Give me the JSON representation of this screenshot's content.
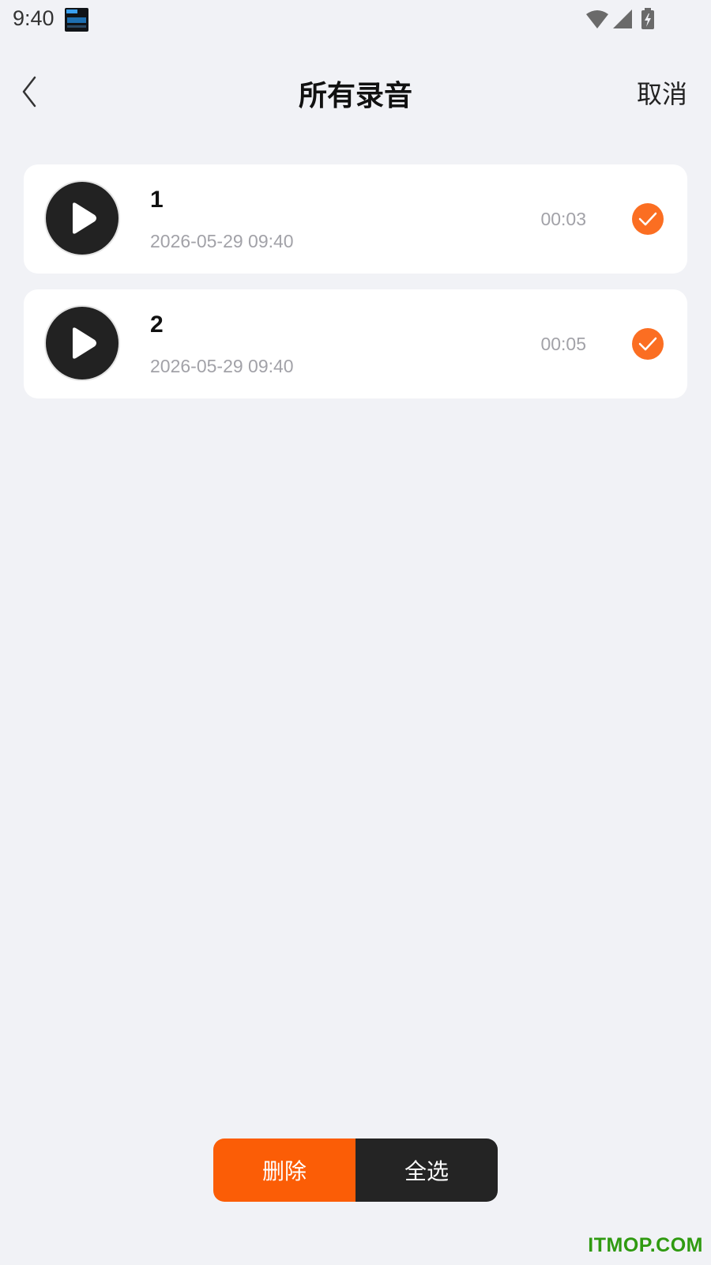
{
  "status_bar": {
    "time": "9:40",
    "icons": [
      "wifi-icon",
      "signal-icon",
      "battery-charging-icon"
    ]
  },
  "header": {
    "title": "所有录音",
    "cancel_label": "取消",
    "back_icon": "chevron-left-icon"
  },
  "recordings": [
    {
      "name": "1",
      "date": "2026-05-29 09:40",
      "duration": "00:03",
      "selected": true
    },
    {
      "name": "2",
      "date": "2026-05-29 09:40",
      "duration": "00:05",
      "selected": true
    }
  ],
  "actions": {
    "delete_label": "删除",
    "select_all_label": "全选"
  },
  "watermark": "ITMOP.COM",
  "colors": {
    "accent": "#fb5d06",
    "check": "#fb6e22",
    "dark": "#242424",
    "background": "#f1f2f6"
  }
}
